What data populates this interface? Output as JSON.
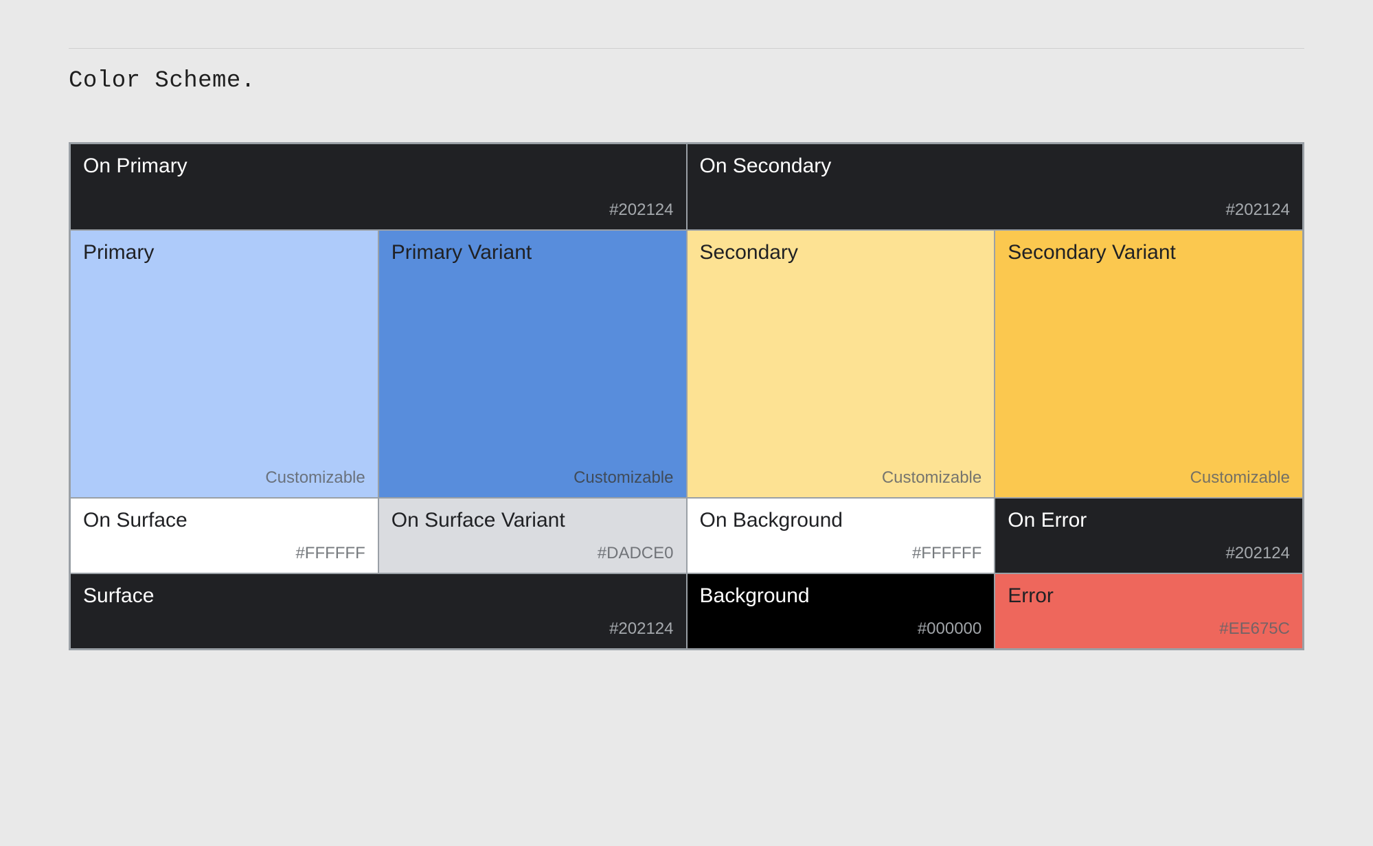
{
  "title": "Color Scheme.",
  "swatches": {
    "onPrimary": {
      "name": "On Primary",
      "value": "#202124",
      "bg": "#202124",
      "fg": "#ffffff",
      "vfg": "#bdc1c6"
    },
    "onSecondary": {
      "name": "On Secondary",
      "value": "#202124",
      "bg": "#202124",
      "fg": "#ffffff",
      "vfg": "#bdc1c6"
    },
    "primary": {
      "name": "Primary",
      "value": "Customizable",
      "bg": "#aecbfa",
      "fg": "#202124",
      "vfg": "#5f6368"
    },
    "primaryVariant": {
      "name": "Primary Variant",
      "value": "Customizable",
      "bg": "#588ddc",
      "fg": "#202124",
      "vfg": "#3c4043"
    },
    "secondary": {
      "name": "Secondary",
      "value": "Customizable",
      "bg": "#fde293",
      "fg": "#202124",
      "vfg": "#5f6368"
    },
    "secondaryVariant": {
      "name": "Secondary Variant",
      "value": "Customizable",
      "bg": "#fbc84f",
      "fg": "#202124",
      "vfg": "#5f6368"
    },
    "onSurface": {
      "name": "On Surface",
      "value": "#FFFFFF",
      "bg": "#ffffff",
      "fg": "#202124",
      "vfg": "#5f6368"
    },
    "onSurfaceVariant": {
      "name": "On Surface Variant",
      "value": "#DADCE0",
      "bg": "#dadce0",
      "fg": "#202124",
      "vfg": "#5f6368"
    },
    "onBackground": {
      "name": "On Background",
      "value": "#FFFFFF",
      "bg": "#ffffff",
      "fg": "#202124",
      "vfg": "#5f6368"
    },
    "onError": {
      "name": "On Error",
      "value": "#202124",
      "bg": "#202124",
      "fg": "#ffffff",
      "vfg": "#bdc1c6"
    },
    "surface": {
      "name": "Surface",
      "value": "#202124",
      "bg": "#202124",
      "fg": "#ffffff",
      "vfg": "#bdc1c6"
    },
    "background": {
      "name": "Background",
      "value": "#000000",
      "bg": "#000000",
      "fg": "#ffffff",
      "vfg": "#bdc1c6"
    },
    "error": {
      "name": "Error",
      "value": "#EE675C",
      "bg": "#ee675c",
      "fg": "#202124",
      "vfg": "#5f6368"
    }
  }
}
